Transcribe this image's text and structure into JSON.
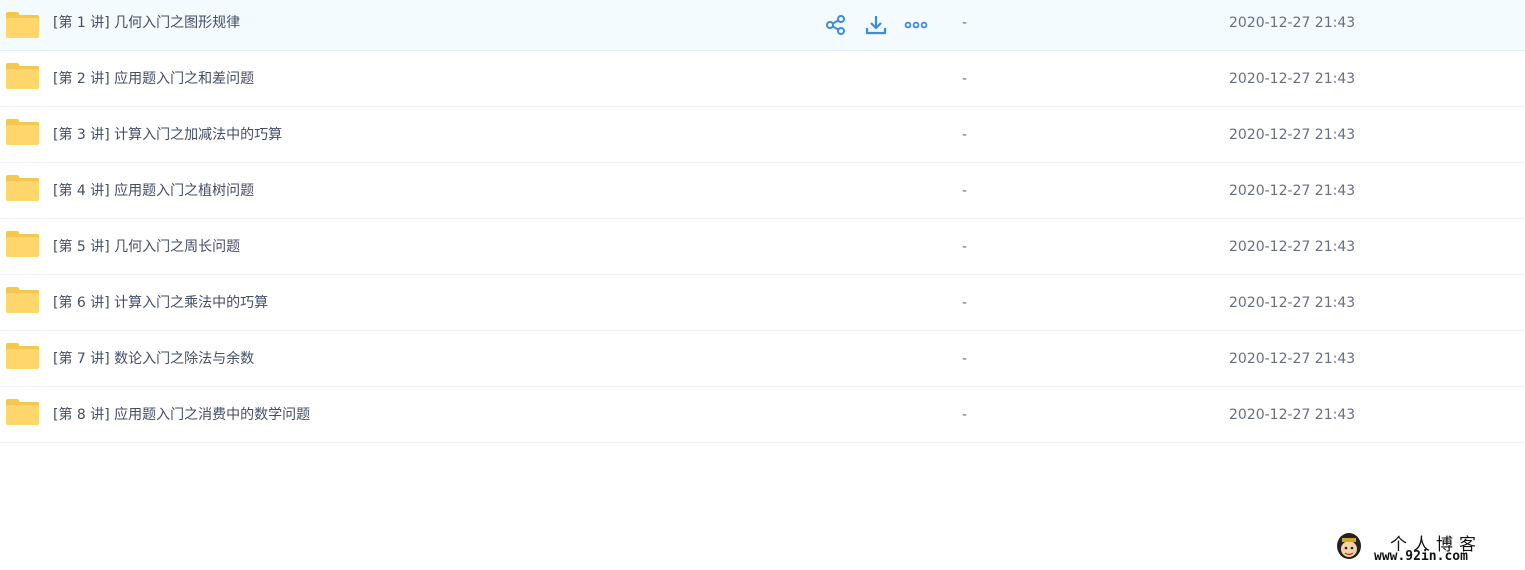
{
  "file_list": {
    "rows": [
      {
        "name": "[第 1 讲] 几何入门之图形规律",
        "size": "-",
        "date": "2020-12-27 21:43"
      },
      {
        "name": "[第 2 讲] 应用题入门之和差问题",
        "size": "-",
        "date": "2020-12-27 21:43"
      },
      {
        "name": "[第 3 讲] 计算入门之加减法中的巧算",
        "size": "-",
        "date": "2020-12-27 21:43"
      },
      {
        "name": "[第 4 讲] 应用题入门之植树问题",
        "size": "-",
        "date": "2020-12-27 21:43"
      },
      {
        "name": "[第 5 讲] 几何入门之周长问题",
        "size": "-",
        "date": "2020-12-27 21:43"
      },
      {
        "name": "[第 6 讲] 计算入门之乘法中的巧算",
        "size": "-",
        "date": "2020-12-27 21:43"
      },
      {
        "name": "[第 7 讲] 数论入门之除法与余数",
        "size": "-",
        "date": "2020-12-27 21:43"
      },
      {
        "name": "[第 8 讲] 应用题入门之消费中的数学问题",
        "size": "-",
        "date": "2020-12-27 21:43"
      }
    ],
    "hover_actions": [
      "share-icon",
      "download-icon",
      "more-icon"
    ]
  },
  "watermark": {
    "title": "个人博客",
    "url": "www.92in.com"
  },
  "colors": {
    "accent": "#3b8cdb",
    "folder": "#ffd66b",
    "hover_row": "#f4fbff",
    "text": "#424e67"
  }
}
